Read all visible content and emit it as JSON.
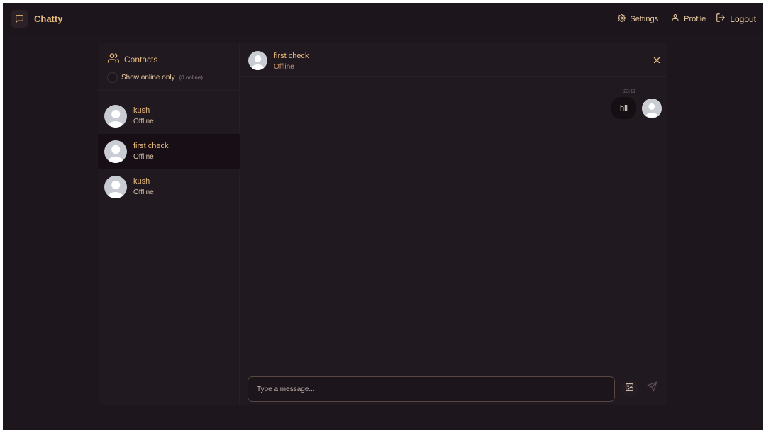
{
  "app": {
    "name": "Chatty"
  },
  "nav": {
    "settings": "Settings",
    "profile": "Profile",
    "logout": "Logout"
  },
  "sidebar": {
    "title": "Contacts",
    "filter_label": "Show online only",
    "online_count": "(0 online)",
    "contacts": [
      {
        "name": "kush",
        "status": "Offline"
      },
      {
        "name": "first check",
        "status": "Offline"
      },
      {
        "name": "kush",
        "status": "Offline"
      }
    ]
  },
  "chat": {
    "name": "first check",
    "status": "Offline",
    "messages": [
      {
        "time": "23:11",
        "text": "hii"
      }
    ],
    "input_placeholder": "Type a message..."
  },
  "colors": {
    "background": "#1e161d",
    "accent": "#e8b97c"
  },
  "icons": {
    "brand": "message-square-icon",
    "settings": "gear-icon",
    "profile": "user-icon",
    "logout": "logout-icon",
    "contacts": "users-icon",
    "close": "close-icon",
    "image": "image-icon",
    "send": "send-icon"
  }
}
